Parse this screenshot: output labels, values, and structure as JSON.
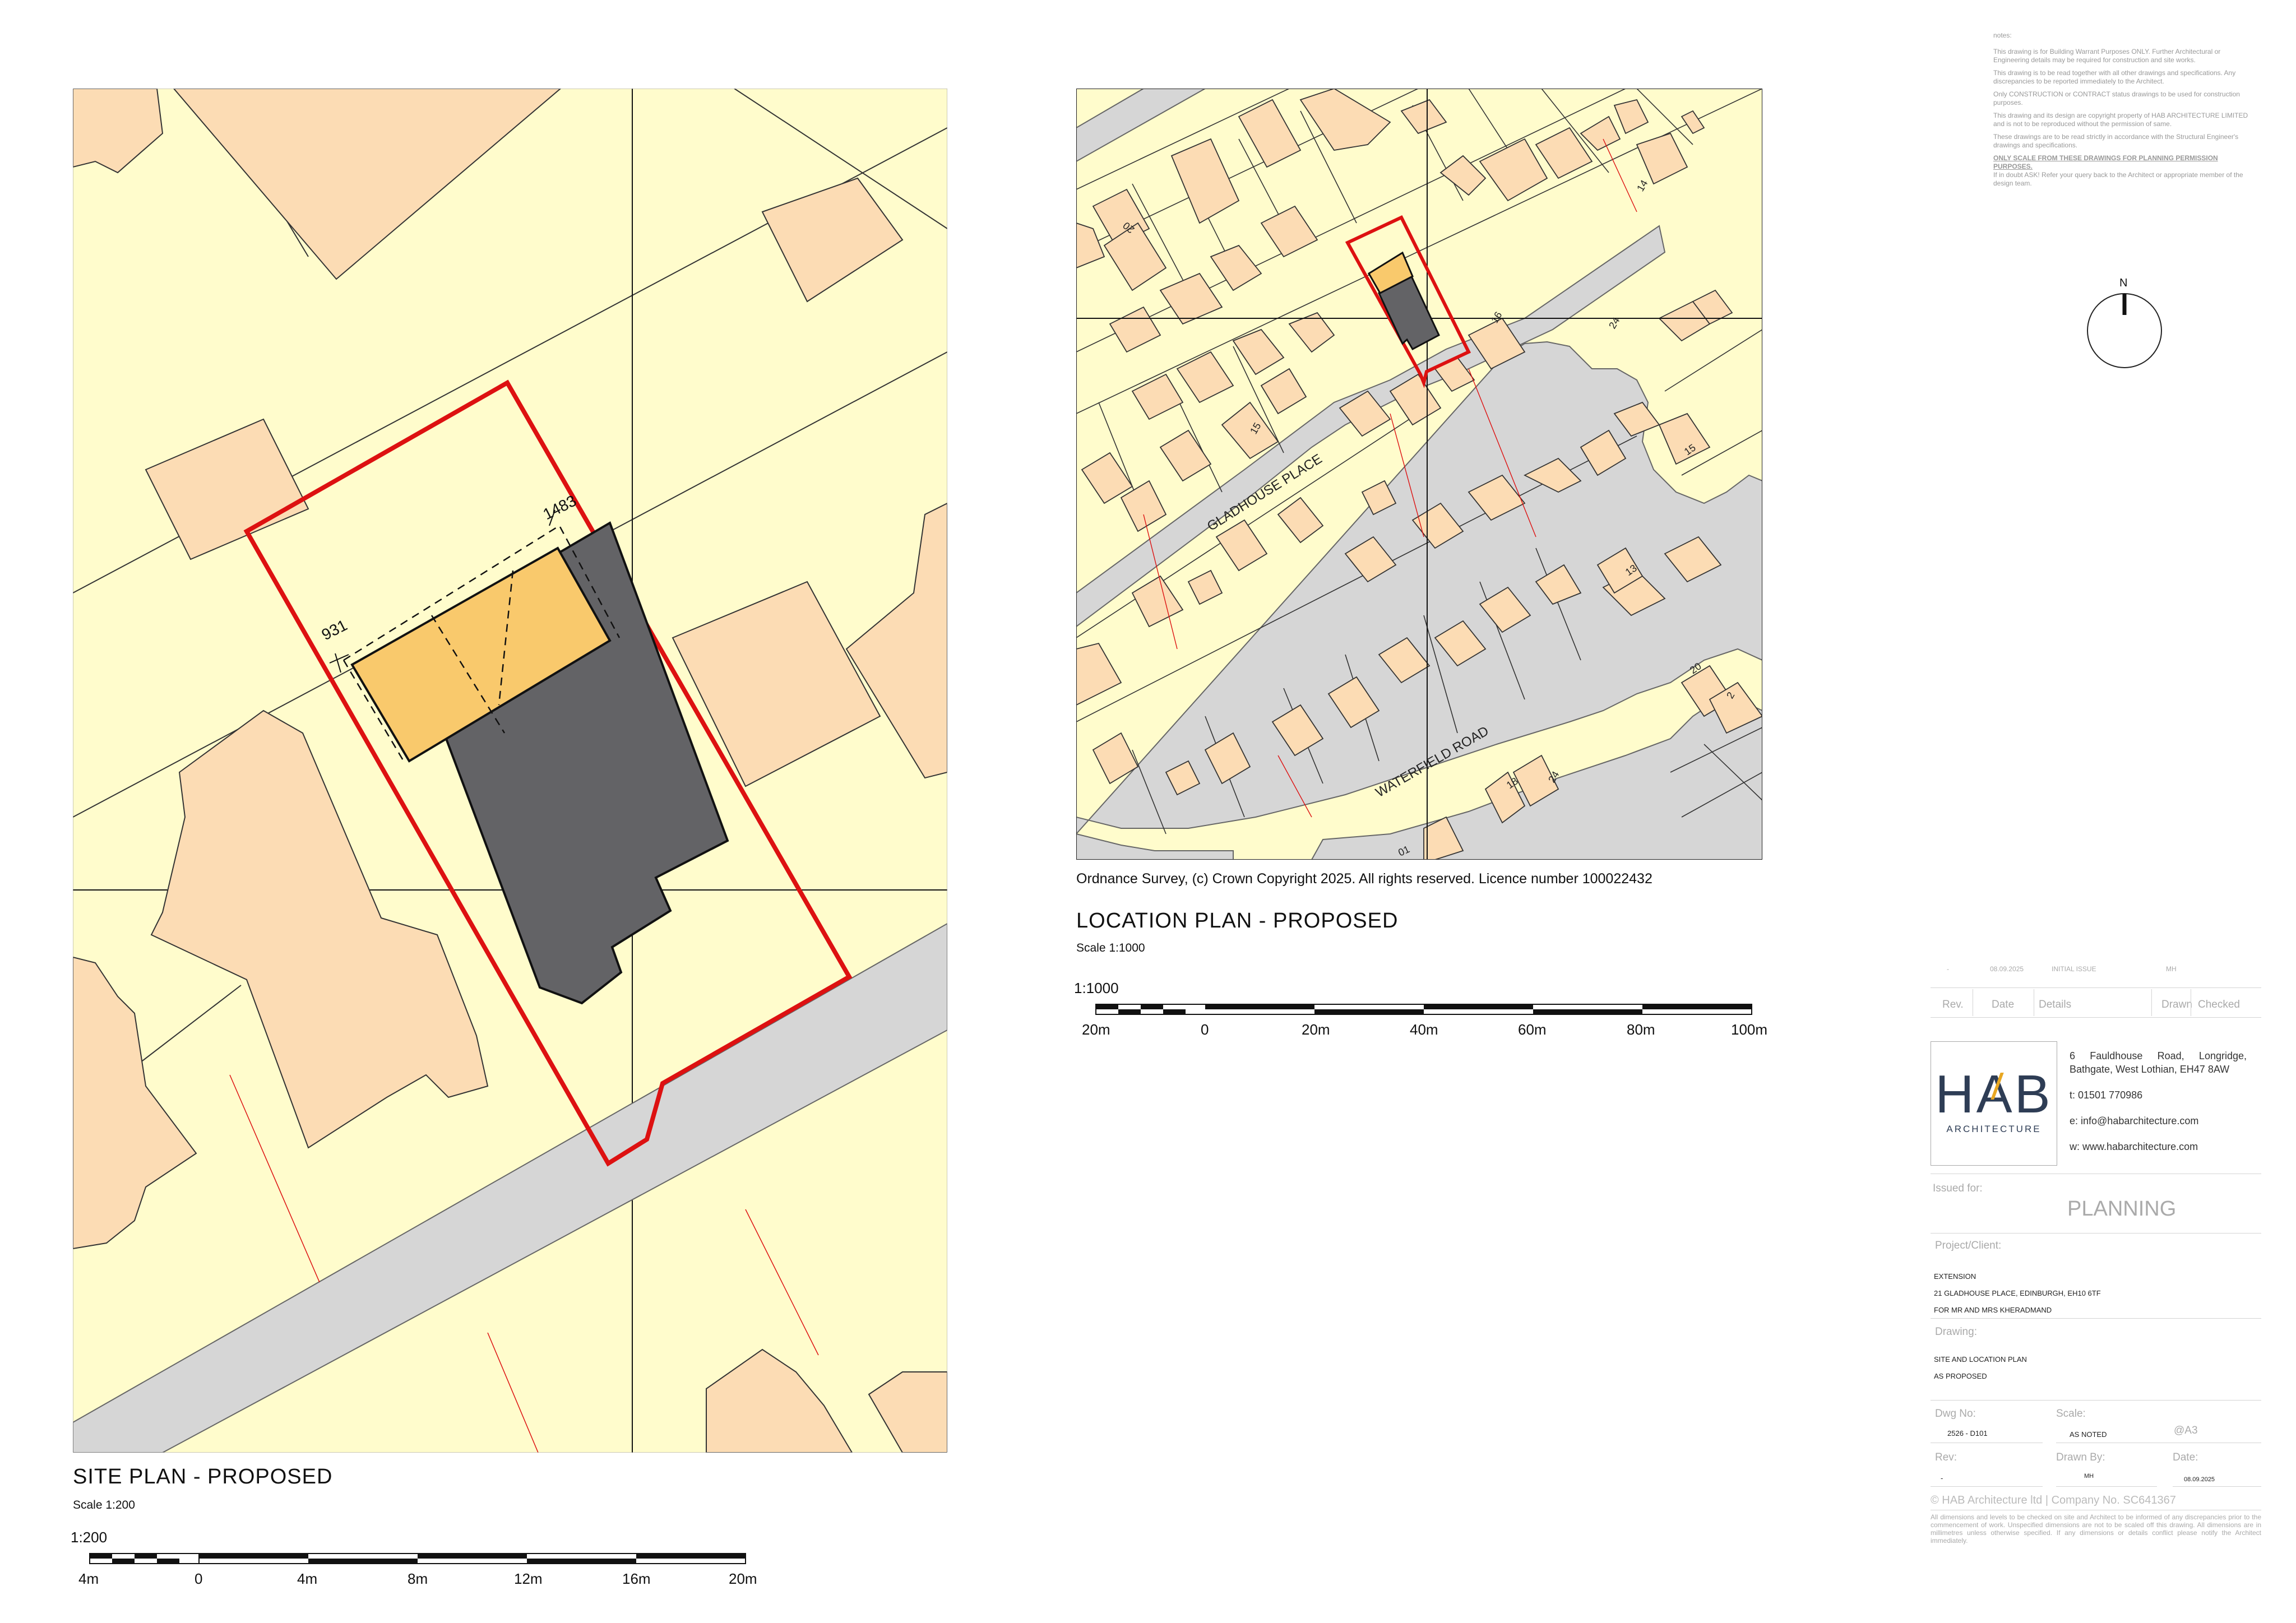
{
  "colors": {
    "land": "#fffccc",
    "building": "#fcdcb4",
    "road": "#d6d6d6",
    "boundary": "#dd1111",
    "extension": "#f9c96c",
    "existing": "#636366",
    "hab_dark": "#2e3d55",
    "hab_accent": "#e8a722"
  },
  "notes": {
    "heading": "notes:",
    "paragraphs": [
      "This drawing is for Building Warrant Purposes ONLY. Further Architectural or Engineering details may be required for construction and site works.",
      "This drawing is to be read together with all other drawings and specifications. Any discrepancies to be reported immediately to the Architect.",
      "Only CONSTRUCTION or CONTRACT status drawings to be used for construction purposes.",
      "This drawing and its design are copyright property of HAB ARCHITECTURE LIMITED and is not to be reproduced without the permission of same.",
      "These drawings are to be read strictly in accordance with the Structural Engineer's drawings and specifications."
    ],
    "warning": "ONLY SCALE FROM THESE DRAWINGS FOR PLANNING PERMISSION PURPOSES.",
    "footer": "If in doubt ASK! Refer your query back to the Architect or appropriate member of the design team."
  },
  "north": {
    "label": "N"
  },
  "site_plan": {
    "title": "SITE PLAN - PROPOSED",
    "scale_text": "Scale 1:200",
    "bar_label": "1:200",
    "bar_ticks": [
      "4m",
      "0",
      "4m",
      "8m",
      "12m",
      "16m",
      "20m"
    ],
    "dim_front": "931",
    "dim_side": "1483"
  },
  "location_plan": {
    "title": "LOCATION PLAN - PROPOSED",
    "scale_text": "Scale 1:1000",
    "bar_label": "1:1000",
    "bar_ticks": [
      "20m",
      "0",
      "20m",
      "40m",
      "60m",
      "80m",
      "100m"
    ],
    "copyright": "Ordnance Survey, (c) Crown Copyright 2025. All rights reserved. Licence number 100022432",
    "street_1": "GLADHOUSE PLACE",
    "street_2": "WATERFIELD ROAD",
    "house_numbers": [
      "20",
      "15",
      "16",
      "15",
      "13",
      "20",
      "2",
      "18",
      "24",
      "01",
      "14",
      "24"
    ]
  },
  "title_block": {
    "revision": {
      "rev": "-",
      "date": "08.09.2025",
      "details": "INITIAL ISSUE",
      "drawn": "MH"
    },
    "headers": {
      "rev": "Rev.",
      "date": "Date",
      "details": "Details",
      "drawn": "Drawn",
      "checked": "Checked"
    },
    "logo_main": "HAB",
    "logo_sub": "ARCHITECTURE",
    "address": "6 Fauldhouse Road, Longridge, Bathgate, West Lothian, EH47 8AW",
    "tel": "t: 01501 770986",
    "email": "e: info@habarchitecture.com",
    "web": "w: www.habarchitecture.com",
    "issued_for_label": "Issued for:",
    "issued_for": "PLANNING",
    "project_label": "Project/Client:",
    "project_lines": [
      "EXTENSION",
      "21 GLADHOUSE PLACE, EDINBURGH, EH10 6TF",
      "FOR MR AND MRS KHERADMAND"
    ],
    "drawing_label": "Drawing:",
    "drawing_lines": [
      "SITE AND LOCATION PLAN",
      "AS PROPOSED"
    ],
    "dwg_no_label": "Dwg No:",
    "dwg_no": "2526 - D101",
    "scale_label": "Scale:",
    "scale": "AS NOTED",
    "paper": "@A3",
    "rev_label": "Rev:",
    "rev": "-",
    "drawn_by_label": "Drawn By:",
    "drawn_by": "MH",
    "date_label": "Date:",
    "date": "08.09.2025",
    "company": "© HAB Architecture ltd | Company No. SC641367",
    "disclaimer": "All dimensions and levels to be checked on site and Architect to be informed of any discrepancies prior to the commencement of work. Unspecified dimensions are not to be scaled off this drawing. All dimensions are in millimetres unless otherwise specified. If any dimensions or details conflict please notify the Architect immediately."
  }
}
